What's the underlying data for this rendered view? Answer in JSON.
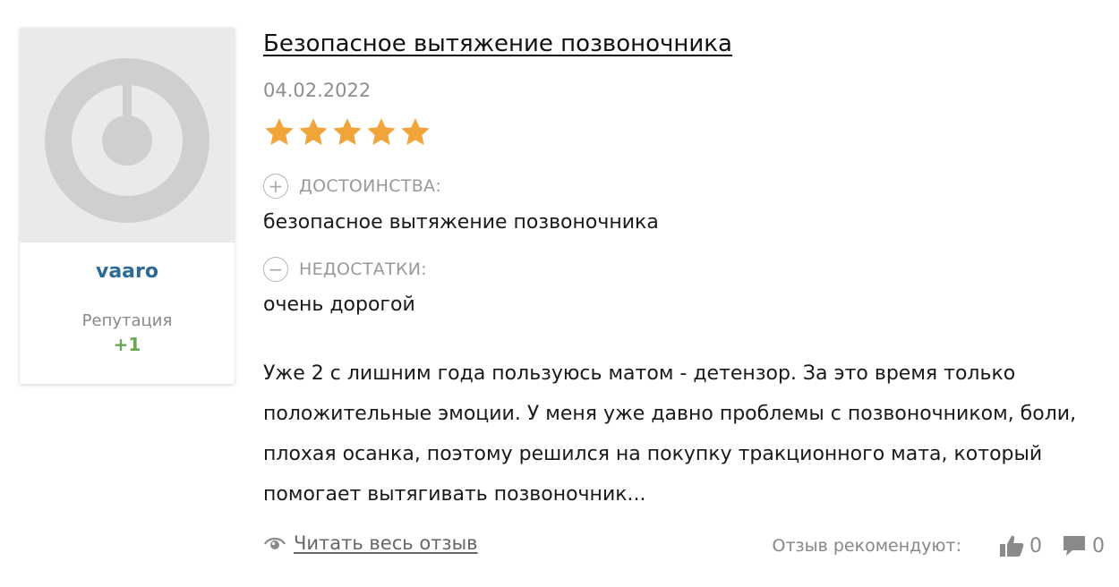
{
  "author": {
    "username": "vaaro",
    "reputation_label": "Репутация",
    "reputation_value": "+1"
  },
  "review": {
    "title": "Безопасное вытяжение позвоночника",
    "date": "04.02.2022",
    "rating": 5,
    "rating_max": 5,
    "pros_label": "ДОСТОИНСТВА:",
    "pros_text": "безопасное вытяжение позвоночника",
    "cons_label": "НЕДОСТАТКИ:",
    "cons_text": "очень дорогой",
    "body": "Уже 2 с лишним года пользуюсь матом - детензор. За это время только положительные эмоции. У меня уже давно проблемы с позвоночником, боли, плохая осанка, поэтому решился на покупку тракционного мата, который помогает вытягивать позвоночник...",
    "read_more_label": "Читать весь отзыв",
    "recommend_label": "Отзыв рекомендуют:",
    "likes": "0",
    "comments": "0"
  },
  "icons": {
    "avatar": "default-avatar-icon",
    "star": "star-icon",
    "pros": "plus-circle-icon",
    "cons": "minus-circle-icon",
    "read_more": "eye-icon",
    "like": "thumbs-up-icon",
    "comments": "comment-icon"
  },
  "colors": {
    "star": "#f0a43a",
    "username": "#2e6a96",
    "reputation": "#6aa84f",
    "avatar_bg": "#eaeaea",
    "avatar_fg": "#cfcfcf"
  }
}
